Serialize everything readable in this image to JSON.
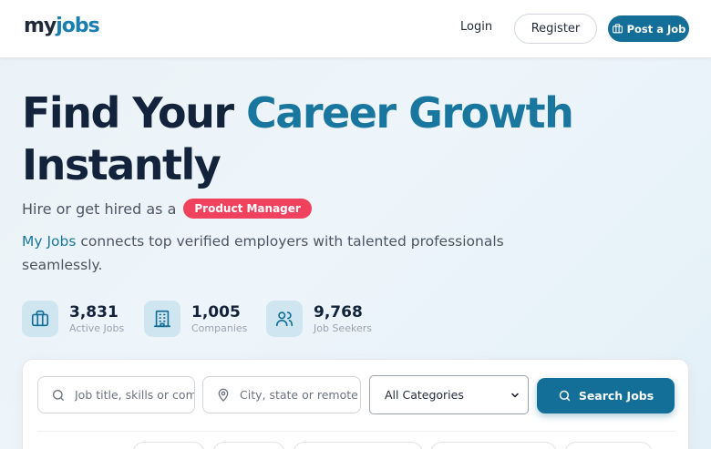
{
  "header": {
    "logo_my": "my",
    "logo_jobs": "jobs",
    "login_label": "Login",
    "register_label": "Register",
    "post_job_label": "Post a Job"
  },
  "hero": {
    "title_part1": "Find Your ",
    "title_accent": "Career Growth",
    "title_part2": "Instantly",
    "subtitle_prefix": "Hire or get hired as a",
    "role_badge": "Product Manager",
    "desc_brand": "My Jobs",
    "desc_rest": " connects top verified employers with talented professionals seamlessly."
  },
  "stats": [
    {
      "value": "3,831",
      "label": "Active Jobs",
      "icon": "briefcase-icon"
    },
    {
      "value": "1,005",
      "label": "Companies",
      "icon": "building-icon"
    },
    {
      "value": "9,768",
      "label": "Job Seekers",
      "icon": "users-icon"
    }
  ],
  "search": {
    "keyword_placeholder": "Job title, skills or company",
    "location_placeholder": "City, state or remote",
    "category_selected": "All Categories",
    "button_label": "Search Jobs"
  },
  "colors": {
    "primary": "#136e98",
    "accent_text": "#19779f",
    "badge": "#f0425e",
    "dark_text": "#12233b"
  }
}
